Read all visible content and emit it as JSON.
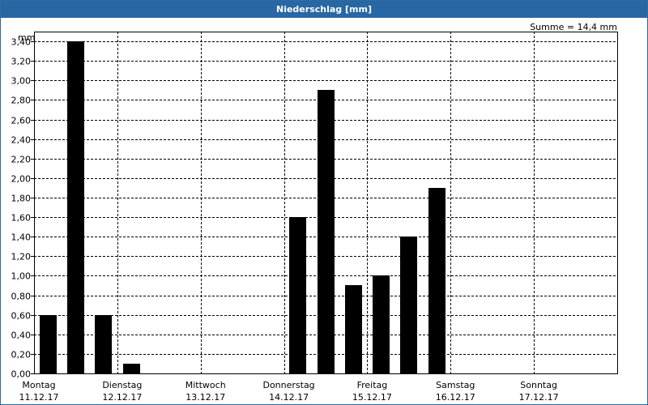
{
  "window": {
    "title": "Niederschlag [mm]"
  },
  "summary": {
    "text": "Summe = 14,4 mm"
  },
  "colors": {
    "titlebar": "#2867a4",
    "bar": "#000000",
    "grid": "#000000",
    "background": "#ffffff"
  },
  "chart_data": {
    "type": "bar",
    "title": "Niederschlag [mm]",
    "ylabel": "mm",
    "xlabel": "",
    "ylim": [
      0,
      3.5
    ],
    "y_ticks": [
      "0,00",
      "0,20",
      "0,40",
      "0,60",
      "0,80",
      "1,00",
      "1,20",
      "1,40",
      "1,60",
      "1,80",
      "2,00",
      "2,20",
      "2,40",
      "2,60",
      "2,80",
      "3,00",
      "3,20",
      "3,40"
    ],
    "grid": true,
    "days": [
      {
        "name": "Montag",
        "date": "11.12.17"
      },
      {
        "name": "Dienstag",
        "date": "12.12.17"
      },
      {
        "name": "Mittwoch",
        "date": "13.12.17"
      },
      {
        "name": "Donnerstag",
        "date": "14.12.17"
      },
      {
        "name": "Freitag",
        "date": "15.12.17"
      },
      {
        "name": "Samstag",
        "date": "16.12.17"
      },
      {
        "name": "Sonntag",
        "date": "17.12.17"
      }
    ],
    "bars_per_day": 3,
    "values": [
      0.6,
      3.4,
      0.6,
      0.1,
      0,
      0,
      0,
      0,
      0,
      1.6,
      2.9,
      0.9,
      1.0,
      1.4,
      1.9,
      0,
      0,
      0,
      0,
      0,
      0
    ]
  }
}
